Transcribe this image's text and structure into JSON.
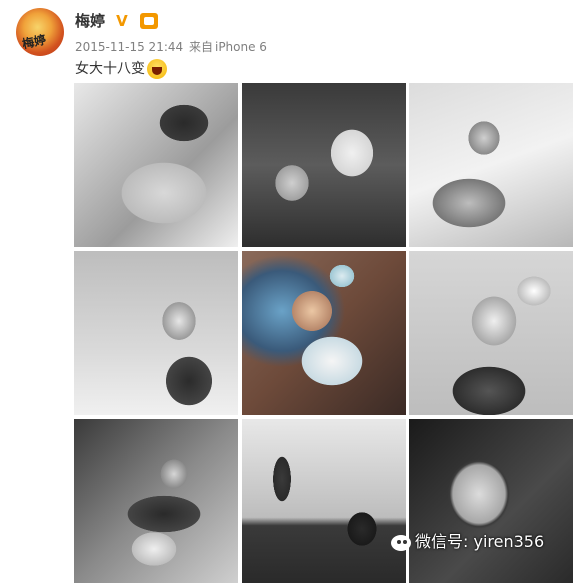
{
  "post": {
    "username": "梅婷",
    "verified_badge": "V",
    "timestamp": "2015-11-15 21:44",
    "source_prefix": "来自",
    "source_device": "iPhone 6",
    "text": "女大十八变",
    "emoji_icon": "laughing-face-icon"
  },
  "avatar": {
    "label": "梅婷"
  },
  "photos": {
    "count": 9
  },
  "watermark": {
    "text": "微信号: yiren356"
  },
  "colors": {
    "badge": "#f39800",
    "meta": "#808080",
    "text": "#333333"
  }
}
